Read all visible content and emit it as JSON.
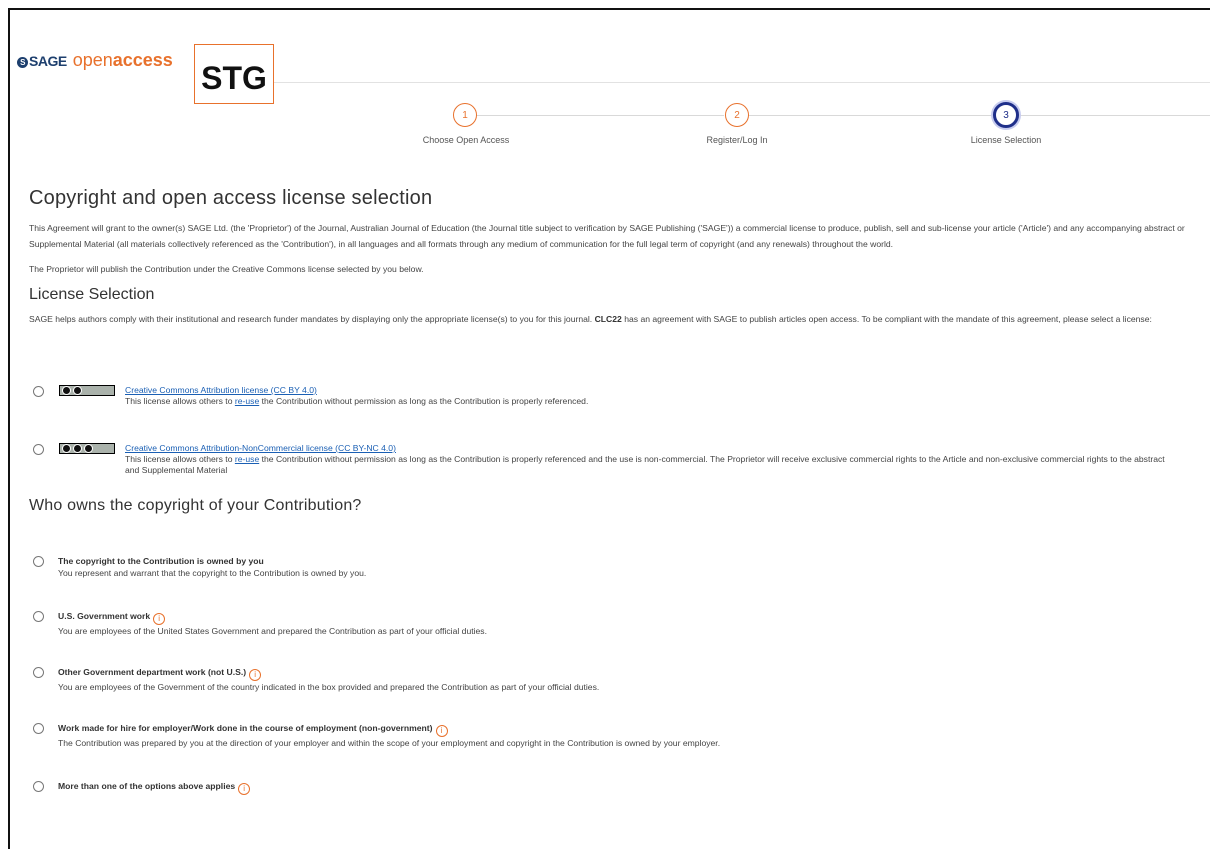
{
  "brand": {
    "sage": "SAGE",
    "open": "open",
    "access": "access",
    "env_badge": "STG"
  },
  "steps": [
    {
      "number": "1",
      "label": "Choose Open Access"
    },
    {
      "number": "2",
      "label": "Register/Log In"
    },
    {
      "number": "3",
      "label": "License Selection"
    }
  ],
  "page": {
    "title": "Copyright and open access license selection",
    "agreement_text": "This Agreement will grant to the owner(s) SAGE Ltd. (the 'Proprietor') of the Journal, Australian Journal of Education (the Journal title subject to verification by SAGE Publishing ('SAGE')) a commercial license to produce, publish, sell and sub-license your article ('Article') and any accompanying abstract or Supplemental Material (all materials collectively referenced as the 'Contribution'), in all languages and all formats through any medium of communication for the full legal term of copyright (and any renewals) throughout the world.",
    "publish_text": "The Proprietor will publish the Contribution under the Creative Commons license selected by you below."
  },
  "license_section": {
    "heading": "License Selection",
    "intro_pre": "SAGE helps authors comply with their institutional and research funder mandates by displaying only the appropriate license(s) to you for this journal. ",
    "intro_bold": "CLC22",
    "intro_post": " has an agreement with SAGE to publish articles open access. To be compliant with the mandate of this agreement, please select a license:",
    "options": [
      {
        "name": "Creative Commons Attribution license (CC BY 4.0)",
        "desc_pre": "This license allows others to ",
        "desc_link": "re-use",
        "desc_post": " the Contribution without permission as long as the Contribution is properly referenced."
      },
      {
        "name": "Creative Commons Attribution-NonCommercial license (CC BY-NC 4.0)",
        "desc_pre": "This license allows others to ",
        "desc_link": "re-use",
        "desc_post": " the Contribution without permission as long as the Contribution is properly referenced and the use is non-commercial. The Proprietor will receive exclusive commercial rights to the Article and non-exclusive commercial rights to the abstract and Supplemental Material"
      }
    ]
  },
  "ownership": {
    "heading": "Who owns the copyright of your Contribution?",
    "info_glyph": "i",
    "options": [
      {
        "title": "The copyright to the Contribution is owned by you",
        "desc": "You represent and warrant that the copyright to the Contribution is owned by you."
      },
      {
        "title": "U.S. Government work",
        "desc": "You are employees of the United States Government and prepared the Contribution as part of your official duties."
      },
      {
        "title": "Other Government department work (not U.S.)",
        "desc": "You are employees of the Government of the country indicated in the box provided and prepared the Contribution as part of your official duties."
      },
      {
        "title": "Work made for hire for employer/Work done in the course of employment (non-government)",
        "desc": "The Contribution was prepared by you at the direction of your employer and within the scope of your employment and copyright in the Contribution is owned by your employer."
      },
      {
        "title": "More than one of the options above applies",
        "desc": ""
      }
    ]
  },
  "colors": {
    "accent_orange": "#e8712c",
    "active_step": "#1f2f8a",
    "link": "#1a5fb4"
  }
}
